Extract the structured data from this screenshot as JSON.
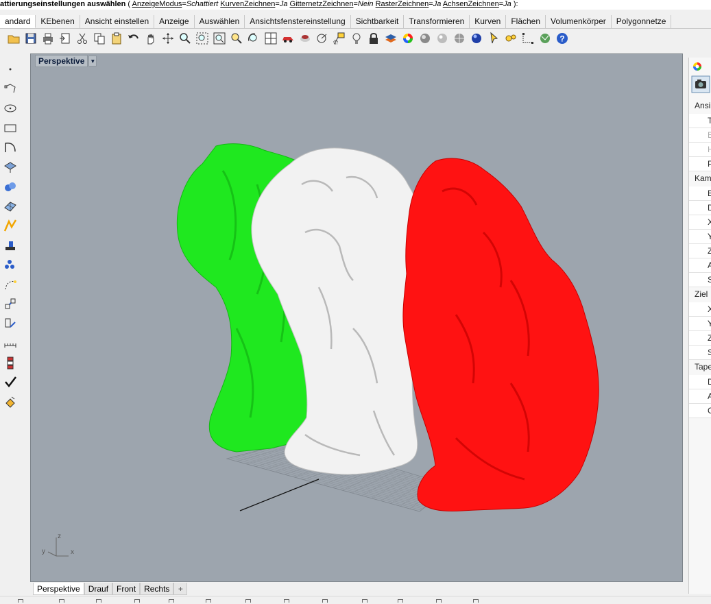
{
  "command_line": {
    "prompt": "attierungseinstellungen auswählen",
    "paren_open": " ( ",
    "options": [
      {
        "name": "AnzeigeModus",
        "value": "Schattiert"
      },
      {
        "name": "KurvenZeichnen",
        "value": "Ja"
      },
      {
        "name": "GitternetzZeichnen",
        "value": "Nein"
      },
      {
        "name": "RasterZeichnen",
        "value": "Ja"
      },
      {
        "name": "AchsenZeichnen",
        "value": "Ja"
      }
    ],
    "paren_close": " ):"
  },
  "tabs": [
    {
      "label": "andard",
      "active": true
    },
    {
      "label": "KEbenen"
    },
    {
      "label": "Ansicht einstellen"
    },
    {
      "label": "Anzeige"
    },
    {
      "label": "Auswählen"
    },
    {
      "label": "Ansichtsfenstereinstellung"
    },
    {
      "label": "Sichtbarkeit"
    },
    {
      "label": "Transformieren"
    },
    {
      "label": "Kurven"
    },
    {
      "label": "Flächen"
    },
    {
      "label": "Volumenkörper"
    },
    {
      "label": "Polygonnetze"
    }
  ],
  "toolbar_icons": [
    "open-icon",
    "save-icon",
    "print-icon",
    "import-icon",
    "cut-icon",
    "copy-icon",
    "paste-icon",
    "undo-icon",
    "pan-icon",
    "rotate-view-icon",
    "zoom-icon",
    "zoom-window-icon",
    "zoom-extents-icon",
    "zoom-selected-icon",
    "rotate-camera-icon",
    "four-viewports-icon",
    "car-icon",
    "render-material-icon",
    "cplane-icon",
    "point-snap-icon",
    "light-bulb-icon",
    "lock-icon",
    "layer-icon",
    "color-wheel-icon",
    "sphere-icon",
    "ghosted-sphere-icon",
    "rendered-sphere-icon",
    "blue-sphere-icon",
    "select-arrow-icon",
    "options-gear-icon",
    "dimension-icon",
    "globe-icon",
    "help-icon"
  ],
  "viewport": {
    "title": "Perspektive",
    "axis_labels": {
      "z": "z",
      "y": "y",
      "x": "x"
    },
    "colors": {
      "background": "#9da5ae",
      "green": "#1ee81e",
      "white": "#f4f4f4",
      "red": "#ff1010"
    }
  },
  "viewport_tabs": [
    {
      "label": "Perspektive",
      "active": true
    },
    {
      "label": "Drauf"
    },
    {
      "label": "Front"
    },
    {
      "label": "Rechts"
    }
  ],
  "add_viewport_label": "+",
  "left_toolbar_icons": [
    "point-icon",
    "polyline-icon",
    "circle-icon",
    "rectangle-icon",
    "curve-icon",
    "surface-icon",
    "solid-icon",
    "mesh-icon",
    "transform-icon",
    "boolean-icon",
    "array-icon",
    "edit-point-icon",
    "scale-icon",
    "extrude-icon",
    "dimension-left-icon",
    "layer-stack-icon",
    "check-icon",
    "paint-bucket-icon"
  ],
  "right_panel": {
    "items": [
      {
        "label": "Ansi",
        "type": "section"
      },
      {
        "label": "T",
        "type": "item"
      },
      {
        "label": "B",
        "type": "item",
        "dim": true
      },
      {
        "label": "H",
        "type": "item",
        "dim": true
      },
      {
        "label": "P",
        "type": "item"
      },
      {
        "label": "Kam",
        "type": "section"
      },
      {
        "label": "B",
        "type": "item"
      },
      {
        "label": "D",
        "type": "item"
      },
      {
        "label": "X",
        "type": "item"
      },
      {
        "label": "Y",
        "type": "item"
      },
      {
        "label": "Z",
        "type": "item"
      },
      {
        "label": "A",
        "type": "item"
      },
      {
        "label": "S",
        "type": "item"
      },
      {
        "label": "Ziel",
        "type": "section"
      },
      {
        "label": "X",
        "type": "item"
      },
      {
        "label": "Y",
        "type": "item"
      },
      {
        "label": "Z",
        "type": "item"
      },
      {
        "label": "S",
        "type": "item"
      },
      {
        "label": "Tape",
        "type": "section"
      },
      {
        "label": "D",
        "type": "item"
      },
      {
        "label": "A",
        "type": "item"
      },
      {
        "label": "G",
        "type": "item"
      }
    ]
  }
}
